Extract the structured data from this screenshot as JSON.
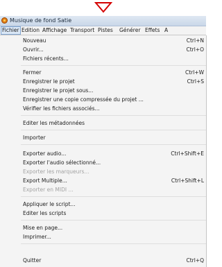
{
  "window": {
    "title": "Musique de fond Satie"
  },
  "menubar": {
    "items": [
      "Fichier",
      "Edition",
      "Affichage",
      "Transport",
      "Pistes",
      "Générer",
      "Effets",
      "A"
    ]
  },
  "file_menu": {
    "items": [
      {
        "label": "Nouveau",
        "shortcut": "Ctrl+N"
      },
      {
        "label": "Ouvrir...",
        "shortcut": "Ctrl+O"
      },
      {
        "label": "Fichiers récents..."
      },
      {
        "label": "Fermer",
        "shortcut": "Ctrl+W"
      },
      {
        "label": "Enregistrer le projet",
        "shortcut": "Ctrl+S"
      },
      {
        "label": "Enregistrer le projet sous..."
      },
      {
        "label": "Enregistrer une copie compressée du projet ..."
      },
      {
        "label": "Vérifier les fichiers associés..."
      },
      {
        "label": "Editer les métadonnées"
      },
      {
        "label": "Importer"
      },
      {
        "label": "Exporter audio...",
        "shortcut": "Ctrl+Shift+E"
      },
      {
        "label": "Exporter l'audio sélectionné..."
      },
      {
        "label": "Exporter les marqueurs...",
        "disabled": true
      },
      {
        "label": "Export Multiple...",
        "shortcut": "Ctrl+Shift+L"
      },
      {
        "label": "Exporter en MIDI ...",
        "disabled": true
      },
      {
        "label": "Appliquer le script..."
      },
      {
        "label": "Editer les scripts"
      },
      {
        "label": "Mise en page..."
      },
      {
        "label": "Imprimer..."
      },
      {
        "label": "Quitter",
        "shortcut": "Ctrl+Q"
      }
    ]
  },
  "annotations": {
    "arrow_color": "#e00000"
  }
}
